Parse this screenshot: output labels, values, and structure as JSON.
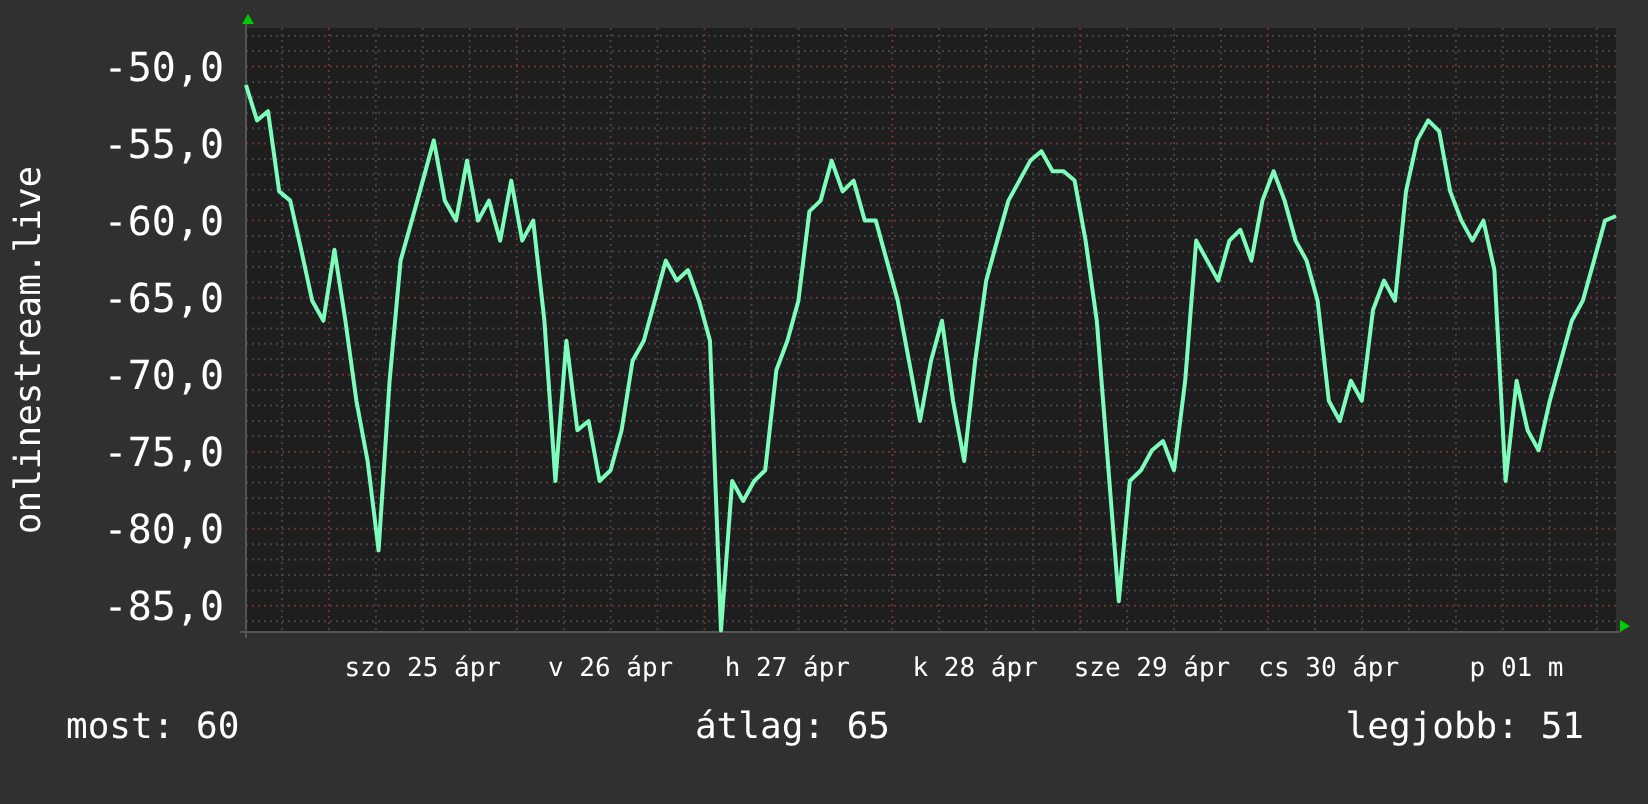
{
  "chart_data": {
    "type": "line",
    "ylabel": "onlinestream.live",
    "ylim": [
      -86.7,
      -47.5
    ],
    "yticks": [
      {
        "value": -50,
        "label": "-50,0"
      },
      {
        "value": -55,
        "label": "-55,0"
      },
      {
        "value": -60,
        "label": "-60,0"
      },
      {
        "value": -65,
        "label": "-65,0"
      },
      {
        "value": -70,
        "label": "-70,0"
      },
      {
        "value": -75,
        "label": "-75,0"
      },
      {
        "value": -80,
        "label": "-80,0"
      },
      {
        "value": -85,
        "label": "-85,0"
      }
    ],
    "grid": true,
    "categories": [
      null,
      null,
      null,
      null,
      null,
      null,
      null,
      null,
      null,
      null,
      null,
      null,
      null,
      null,
      null,
      null,
      "szo 25 ápr",
      null,
      null,
      null,
      null,
      null,
      null,
      null,
      null,
      null,
      null,
      null,
      null,
      null,
      null,
      null,
      null,
      "v 26 ápr",
      null,
      null,
      null,
      null,
      null,
      null,
      null,
      null,
      null,
      null,
      null,
      null,
      null,
      null,
      null,
      "h 27 ápr",
      null,
      null,
      null,
      null,
      null,
      null,
      null,
      null,
      null,
      null,
      null,
      null,
      null,
      null,
      null,
      null,
      "k 28 ápr",
      null,
      null,
      null,
      null,
      null,
      null,
      null,
      null,
      null,
      null,
      null,
      null,
      null,
      null,
      null,
      "sze 29 ápr",
      null,
      null,
      null,
      null,
      null,
      null,
      null,
      null,
      null,
      null,
      null,
      null,
      null,
      null,
      null,
      "cs 30 ápr",
      null,
      null,
      null,
      null,
      null,
      null,
      null,
      null,
      null,
      null,
      null,
      null,
      null,
      null,
      null,
      null,
      "p 01 m",
      null,
      null,
      null,
      null,
      null,
      null,
      null,
      null,
      null
    ],
    "series": [
      {
        "color": "#7dfcbc",
        "values": [
          -51.2,
          -53.5,
          -52.9,
          -58.1,
          -58.7,
          -61.9,
          -65.2,
          -66.5,
          -61.9,
          -66.5,
          -71.7,
          -75.6,
          -81.4,
          -70.4,
          -62.6,
          -60,
          -57.4,
          -54.8,
          -58.7,
          -60,
          -56.1,
          -60,
          -58.7,
          -61.3,
          -57.4,
          -61.3,
          -60,
          -66.5,
          -76.9,
          -67.8,
          -73.6,
          -73,
          -76.9,
          -76.2,
          -73.6,
          -69.1,
          -67.8,
          -65.2,
          -62.6,
          -63.9,
          -63.2,
          -65.2,
          -67.8,
          -86.6,
          -76.9,
          -78.2,
          -76.9,
          -76.2,
          -69.7,
          -67.8,
          -65.2,
          -59.4,
          -58.7,
          -56.1,
          -58.1,
          -57.4,
          -60,
          -60,
          -62.6,
          -65.2,
          -69.1,
          -73,
          -69.1,
          -66.5,
          -71.7,
          -75.6,
          -69.1,
          -63.9,
          -61.3,
          -58.7,
          -57.4,
          -56.1,
          -55.5,
          -56.8,
          -56.8,
          -57.4,
          -61.3,
          -66.5,
          -75.6,
          -84.7,
          -76.9,
          -76.2,
          -74.9,
          -74.3,
          -76.2,
          -70.4,
          -61.3,
          -62.6,
          -63.9,
          -61.3,
          -60.6,
          -62.6,
          -58.7,
          -56.8,
          -58.7,
          -61.3,
          -62.6,
          -65.2,
          -71.7,
          -73,
          -70.4,
          -71.7,
          -65.8,
          -63.9,
          -65.2,
          -58.1,
          -54.8,
          -53.5,
          -54.2,
          -58.1,
          -60,
          -61.3,
          -60,
          -63.2,
          -76.9,
          -70.4,
          -73.6,
          -74.9,
          -71.7,
          -69.1,
          -66.5,
          -65.2,
          -62.6,
          -60,
          -59.7
        ]
      }
    ]
  },
  "stats": [
    "most: 60",
    "átlag: 65",
    "legjobb: 51"
  ]
}
